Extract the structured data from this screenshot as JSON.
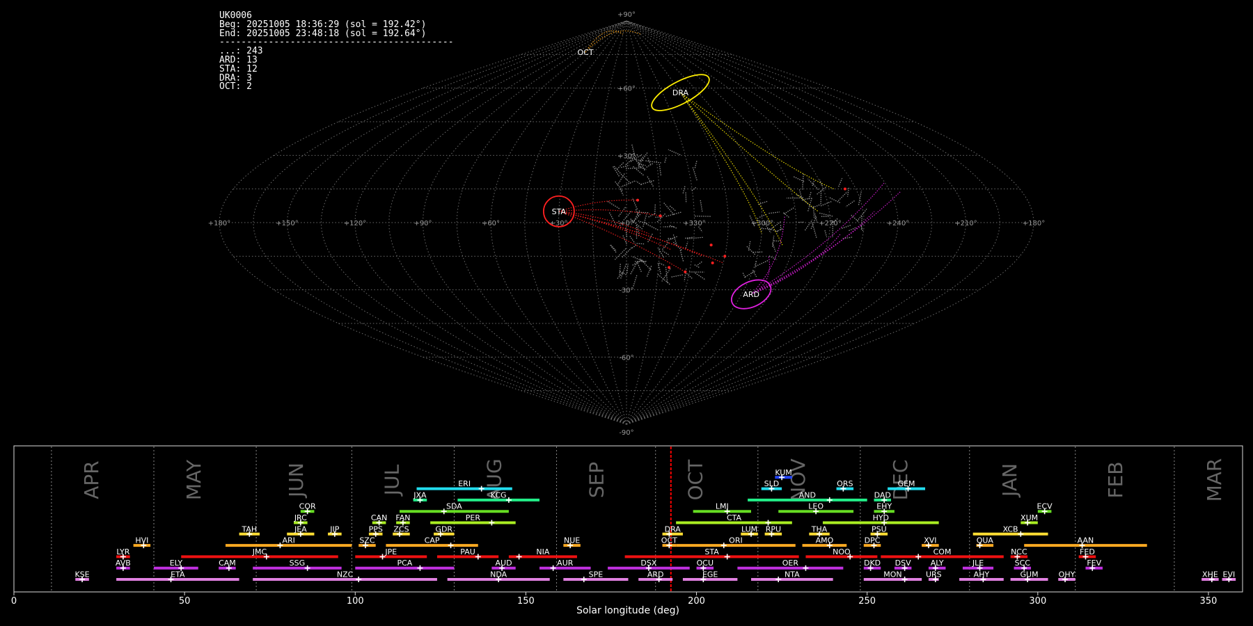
{
  "header": {
    "station": "UK0006",
    "begin": "Beg: 20251005 18:36:29 (sol = 192.42°)",
    "end": "End: 20251005 23:48:18 (sol = 192.64°)",
    "separator": "-------------------------------------------",
    "counts": [
      {
        "code": "...",
        "count": 243
      },
      {
        "code": "ARD",
        "count": 13
      },
      {
        "code": "STA",
        "count": 12
      },
      {
        "code": "DRA",
        "count": 3
      },
      {
        "code": "OCT",
        "count": 2
      }
    ]
  },
  "colors": {
    "grid": "#888888",
    "sporadic": "#c0c0c0",
    "ARD": "#e020e0",
    "STA": "#ff2020",
    "DRA": "#ffee00",
    "OCT": "#ffaa22",
    "current": "#ff0000"
  },
  "chart_data": [
    {
      "type": "scatter",
      "projection": "sinusoidal (sun-centered ecliptic)",
      "lon_labels": [
        "+180°",
        "+150°",
        "+120°",
        "+90°",
        "+60°",
        "+30°",
        "+0°",
        "+330°",
        "+300°",
        "+270°",
        "+240°",
        "+210°",
        "+180°"
      ],
      "lat_labels": [
        "+90°",
        "+60°",
        "+30°",
        "-30°",
        "-60°",
        "-90°"
      ],
      "radiants": [
        {
          "code": "STA",
          "lon": 30,
          "lat": 5
        },
        {
          "code": "DRA",
          "lon": -45,
          "lat": 58
        },
        {
          "code": "ARD",
          "lon": -65,
          "lat": -32
        },
        {
          "code": "OCT",
          "lon": 75,
          "lat": 76
        }
      ]
    },
    {
      "type": "gantt",
      "xlabel": "Solar longitude (deg)",
      "xlim": [
        0,
        360
      ],
      "xticks": [
        0,
        50,
        100,
        150,
        200,
        250,
        300,
        350
      ],
      "current_sol": 192.5,
      "months": [
        {
          "label": "APR",
          "start": 11
        },
        {
          "label": "MAY",
          "start": 41
        },
        {
          "label": "JUN",
          "start": 71
        },
        {
          "label": "JUL",
          "start": 99
        },
        {
          "label": "AUG",
          "start": 129
        },
        {
          "label": "SEP",
          "start": 159
        },
        {
          "label": "OCT",
          "start": 188
        },
        {
          "label": "NOV",
          "start": 218
        },
        {
          "label": "DEC",
          "start": 248
        },
        {
          "label": "JAN",
          "start": 280
        },
        {
          "label": "FEB",
          "start": 311
        },
        {
          "label": "MAR",
          "start": 340
        }
      ],
      "showers": [
        {
          "code": "KSE",
          "start": 18,
          "end": 22,
          "peak": 20,
          "row": 0,
          "color": "#e080e0"
        },
        {
          "code": "ETA",
          "start": 30,
          "end": 66,
          "peak": 46,
          "row": 0,
          "color": "#e080e0"
        },
        {
          "code": "NZC",
          "start": 70,
          "end": 124,
          "peak": 101,
          "row": 0,
          "color": "#e080e0"
        },
        {
          "code": "NDA",
          "start": 127,
          "end": 157,
          "peak": 142,
          "row": 0,
          "color": "#e080e0"
        },
        {
          "code": "SPE",
          "start": 161,
          "end": 180,
          "peak": 167,
          "row": 0,
          "color": "#e080e0"
        },
        {
          "code": "ARD",
          "start": 183,
          "end": 193,
          "peak": 189,
          "row": 0,
          "color": "#e080e0"
        },
        {
          "code": "EGE",
          "start": 196,
          "end": 212,
          "peak": 202,
          "row": 0,
          "color": "#e080e0"
        },
        {
          "code": "NTA",
          "start": 216,
          "end": 240,
          "peak": 224,
          "row": 0,
          "color": "#e080e0"
        },
        {
          "code": "MON",
          "start": 249,
          "end": 266,
          "peak": 261,
          "row": 0,
          "color": "#e080e0"
        },
        {
          "code": "URS",
          "start": 268,
          "end": 271,
          "peak": 270,
          "row": 0,
          "color": "#e080e0"
        },
        {
          "code": "AHY",
          "start": 277,
          "end": 290,
          "peak": 284,
          "row": 0,
          "color": "#e080e0"
        },
        {
          "code": "GUM",
          "start": 292,
          "end": 303,
          "peak": 297,
          "row": 0,
          "color": "#e080e0"
        },
        {
          "code": "OHY",
          "start": 306,
          "end": 311,
          "peak": 308,
          "row": 0,
          "color": "#e080e0"
        },
        {
          "code": "XHE",
          "start": 348,
          "end": 353,
          "peak": 351,
          "row": 0,
          "color": "#e080e0"
        },
        {
          "code": "EVI",
          "start": 354,
          "end": 358,
          "peak": 356,
          "row": 0,
          "color": "#e080e0"
        },
        {
          "code": "AVB",
          "start": 30,
          "end": 34,
          "peak": 32,
          "row": 1,
          "color": "#c030e0"
        },
        {
          "code": "ELY",
          "start": 41,
          "end": 54,
          "peak": 49,
          "row": 1,
          "color": "#c030e0"
        },
        {
          "code": "CAM",
          "start": 60,
          "end": 65,
          "peak": 63,
          "row": 1,
          "color": "#c030e0"
        },
        {
          "code": "SSG",
          "start": 70,
          "end": 96,
          "peak": 86,
          "row": 1,
          "color": "#c030e0"
        },
        {
          "code": "PCA",
          "start": 100,
          "end": 129,
          "peak": 119,
          "row": 1,
          "color": "#c030e0"
        },
        {
          "code": "AUD",
          "start": 140,
          "end": 147,
          "peak": 143,
          "row": 1,
          "color": "#c030e0"
        },
        {
          "code": "AUR",
          "start": 154,
          "end": 169,
          "peak": 158,
          "row": 1,
          "color": "#c030e0"
        },
        {
          "code": "DSX",
          "start": 174,
          "end": 198,
          "peak": 186,
          "row": 1,
          "color": "#c030e0"
        },
        {
          "code": "OCU",
          "start": 200,
          "end": 205,
          "peak": 202,
          "row": 1,
          "color": "#c030e0"
        },
        {
          "code": "OER",
          "start": 212,
          "end": 243,
          "peak": 232,
          "row": 1,
          "color": "#c030e0"
        },
        {
          "code": "DKD",
          "start": 249,
          "end": 254,
          "peak": 251,
          "row": 1,
          "color": "#c030e0"
        },
        {
          "code": "DSV",
          "start": 258,
          "end": 263,
          "peak": 261,
          "row": 1,
          "color": "#c030e0"
        },
        {
          "code": "ALY",
          "start": 268,
          "end": 273,
          "peak": 270,
          "row": 1,
          "color": "#c030e0"
        },
        {
          "code": "JLE",
          "start": 278,
          "end": 287,
          "peak": 283,
          "row": 1,
          "color": "#c030e0"
        },
        {
          "code": "SCC",
          "start": 293,
          "end": 298,
          "peak": 296,
          "row": 1,
          "color": "#c030e0"
        },
        {
          "code": "FEV",
          "start": 314,
          "end": 319,
          "peak": 316,
          "row": 1,
          "color": "#c030e0"
        },
        {
          "code": "LYR",
          "start": 30,
          "end": 34,
          "peak": 32,
          "row": 2,
          "color": "#ee1111"
        },
        {
          "code": "JMC",
          "start": 49,
          "end": 95,
          "peak": 74,
          "row": 2,
          "color": "#ee1111"
        },
        {
          "code": "JPE",
          "start": 100,
          "end": 121,
          "peak": 108,
          "row": 2,
          "color": "#ee1111"
        },
        {
          "code": "PAU",
          "start": 124,
          "end": 142,
          "peak": 136,
          "row": 2,
          "color": "#ee1111"
        },
        {
          "code": "NIA",
          "start": 145,
          "end": 165,
          "peak": 148,
          "row": 2,
          "color": "#ee1111"
        },
        {
          "code": "STA",
          "start": 179,
          "end": 230,
          "peak": 209,
          "row": 2,
          "color": "#ee1111"
        },
        {
          "code": "NOO",
          "start": 232,
          "end": 253,
          "peak": 245,
          "row": 2,
          "color": "#ee1111"
        },
        {
          "code": "COM",
          "start": 254,
          "end": 290,
          "peak": 265,
          "row": 2,
          "color": "#ee1111"
        },
        {
          "code": "NCC",
          "start": 292,
          "end": 297,
          "peak": 294,
          "row": 2,
          "color": "#ee1111"
        },
        {
          "code": "FED",
          "start": 312,
          "end": 317,
          "peak": 314,
          "row": 2,
          "color": "#ee1111"
        },
        {
          "code": "HVI",
          "start": 35,
          "end": 40,
          "peak": 38,
          "row": 3,
          "color": "#ffaa22"
        },
        {
          "code": "ARI",
          "start": 62,
          "end": 99,
          "peak": 78,
          "row": 3,
          "color": "#ffaa22"
        },
        {
          "code": "SZC",
          "start": 101,
          "end": 106,
          "peak": 103,
          "row": 3,
          "color": "#ffaa22"
        },
        {
          "code": "CAP",
          "start": 109,
          "end": 136,
          "peak": 128,
          "row": 3,
          "color": "#ffaa22"
        },
        {
          "code": "NUE",
          "start": 161,
          "end": 166,
          "peak": 163,
          "row": 3,
          "color": "#ffaa22"
        },
        {
          "code": "OCT",
          "start": 190,
          "end": 194,
          "peak": 192,
          "row": 3,
          "color": "#ffaa22"
        },
        {
          "code": "ORI",
          "start": 194,
          "end": 229,
          "peak": 208,
          "row": 3,
          "color": "#ffaa22"
        },
        {
          "code": "AMO",
          "start": 231,
          "end": 244,
          "peak": 239,
          "row": 3,
          "color": "#ffaa22"
        },
        {
          "code": "DPC",
          "start": 249,
          "end": 254,
          "peak": 252,
          "row": 3,
          "color": "#ffaa22"
        },
        {
          "code": "XVI",
          "start": 266,
          "end": 271,
          "peak": 268,
          "row": 3,
          "color": "#ffaa22"
        },
        {
          "code": "QUA",
          "start": 282,
          "end": 287,
          "peak": 283,
          "row": 3,
          "color": "#ffaa22"
        },
        {
          "code": "AAN",
          "start": 296,
          "end": 332,
          "peak": 313,
          "row": 3,
          "color": "#ffaa22"
        },
        {
          "code": "TAH",
          "start": 66,
          "end": 72,
          "peak": 69,
          "row": 4,
          "color": "#ffdd33"
        },
        {
          "code": "JEA",
          "start": 80,
          "end": 88,
          "peak": 84,
          "row": 4,
          "color": "#ffdd33"
        },
        {
          "code": "JIP",
          "start": 92,
          "end": 96,
          "peak": 94,
          "row": 4,
          "color": "#ffdd33"
        },
        {
          "code": "PPS",
          "start": 104,
          "end": 108,
          "peak": 106,
          "row": 4,
          "color": "#ffdd33"
        },
        {
          "code": "ZCS",
          "start": 111,
          "end": 116,
          "peak": 113,
          "row": 4,
          "color": "#ffdd33"
        },
        {
          "code": "GDR",
          "start": 123,
          "end": 129,
          "peak": 125,
          "row": 4,
          "color": "#ffdd33"
        },
        {
          "code": "DRA",
          "start": 190,
          "end": 196,
          "peak": 192,
          "row": 4,
          "color": "#ffdd33"
        },
        {
          "code": "LUM",
          "start": 213,
          "end": 218,
          "peak": 216,
          "row": 4,
          "color": "#ffdd33"
        },
        {
          "code": "RPU",
          "start": 220,
          "end": 225,
          "peak": 222,
          "row": 4,
          "color": "#ffdd33"
        },
        {
          "code": "THA",
          "start": 233,
          "end": 239,
          "peak": 236,
          "row": 4,
          "color": "#ffdd33"
        },
        {
          "code": "PSU",
          "start": 251,
          "end": 256,
          "peak": 253,
          "row": 4,
          "color": "#ffdd33"
        },
        {
          "code": "XCB",
          "start": 281,
          "end": 303,
          "peak": 295,
          "row": 4,
          "color": "#ffdd33"
        },
        {
          "code": "JRC",
          "start": 82,
          "end": 86,
          "peak": 84,
          "row": 5,
          "color": "#aaee22"
        },
        {
          "code": "CAN",
          "start": 105,
          "end": 109,
          "peak": 107,
          "row": 5,
          "color": "#aaee22"
        },
        {
          "code": "FAN",
          "start": 112,
          "end": 116,
          "peak": 114,
          "row": 5,
          "color": "#aaee22"
        },
        {
          "code": "PER",
          "start": 122,
          "end": 147,
          "peak": 140,
          "row": 5,
          "color": "#aaee22"
        },
        {
          "code": "CTA",
          "start": 194,
          "end": 228,
          "peak": 221,
          "row": 5,
          "color": "#aaee22"
        },
        {
          "code": "HYD",
          "start": 237,
          "end": 271,
          "peak": 255,
          "row": 5,
          "color": "#aaee22"
        },
        {
          "code": "XUM",
          "start": 295,
          "end": 300,
          "peak": 297,
          "row": 5,
          "color": "#aaee22"
        },
        {
          "code": "COR",
          "start": 84,
          "end": 88,
          "peak": 86,
          "row": 6,
          "color": "#66dd22"
        },
        {
          "code": "SDA",
          "start": 113,
          "end": 145,
          "peak": 126,
          "row": 6,
          "color": "#66dd22"
        },
        {
          "code": "LMI",
          "start": 199,
          "end": 216,
          "peak": 209,
          "row": 6,
          "color": "#66dd22"
        },
        {
          "code": "LEO",
          "start": 224,
          "end": 246,
          "peak": 235,
          "row": 6,
          "color": "#66dd22"
        },
        {
          "code": "EHY",
          "start": 252,
          "end": 258,
          "peak": 255,
          "row": 6,
          "color": "#66dd22"
        },
        {
          "code": "ECV",
          "start": 300,
          "end": 304,
          "peak": 302,
          "row": 6,
          "color": "#66dd22"
        },
        {
          "code": "JXA",
          "start": 117,
          "end": 121,
          "peak": 119,
          "row": 7,
          "color": "#22ee88"
        },
        {
          "code": "KCG",
          "start": 130,
          "end": 154,
          "peak": 145,
          "row": 7,
          "color": "#22ee88"
        },
        {
          "code": "AND",
          "start": 215,
          "end": 250,
          "peak": 239,
          "row": 7,
          "color": "#22ee88"
        },
        {
          "code": "DAD",
          "start": 252,
          "end": 257,
          "peak": 255,
          "row": 7,
          "color": "#22ee88"
        },
        {
          "code": "ERI",
          "start": 118,
          "end": 146,
          "peak": 137,
          "row": 8,
          "color": "#22ddee"
        },
        {
          "code": "SLD",
          "start": 219,
          "end": 225,
          "peak": 222,
          "row": 8,
          "color": "#22ddee"
        },
        {
          "code": "ORS",
          "start": 241,
          "end": 246,
          "peak": 243,
          "row": 8,
          "color": "#22ddee"
        },
        {
          "code": "GEM",
          "start": 256,
          "end": 267,
          "peak": 262,
          "row": 8,
          "color": "#22ddee"
        },
        {
          "code": "KUM",
          "start": 223,
          "end": 228,
          "peak": 225,
          "row": 9,
          "color": "#2244ff"
        }
      ]
    }
  ]
}
